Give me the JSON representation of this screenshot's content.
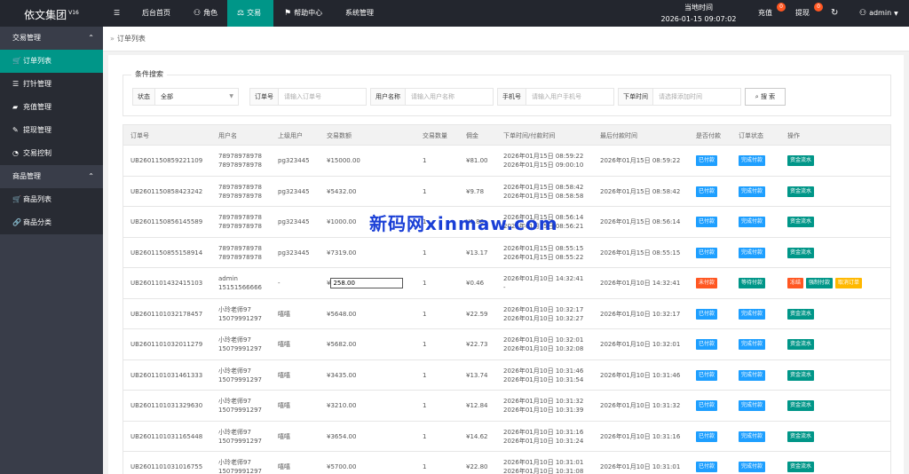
{
  "brand": {
    "name": "依文集团",
    "version": "V16"
  },
  "topnav": {
    "menu_icon": "☰",
    "items": [
      {
        "icon": "",
        "label": "后台首页"
      },
      {
        "icon": "user-icon",
        "label": "角色"
      },
      {
        "icon": "scale-icon",
        "label": "交易"
      },
      {
        "icon": "flag-icon",
        "label": "帮助中心"
      },
      {
        "icon": "",
        "label": "系统管理"
      }
    ],
    "time_label": "当地时间",
    "time_value": "2026-01-15 09:07:02",
    "recharge_label": "充值",
    "recharge_count": "0",
    "withdraw_label": "提现",
    "withdraw_count": "0",
    "refresh_icon": "refresh-icon",
    "user": "admin",
    "accent_color": "#009688"
  },
  "sidebar": {
    "groups": [
      {
        "label": "交易管理",
        "items": [
          {
            "icon": "cart-icon",
            "label": "订单列表"
          },
          {
            "icon": "list-icon",
            "label": "打针管理"
          },
          {
            "icon": "chat-icon",
            "label": "充值管理"
          },
          {
            "icon": "hammer-icon",
            "label": "提现管理"
          },
          {
            "icon": "dashboard-icon",
            "label": "交易控制"
          }
        ]
      },
      {
        "label": "商品管理",
        "items": [
          {
            "icon": "cart-icon",
            "label": "商品列表"
          },
          {
            "icon": "link-icon",
            "label": "商品分类"
          }
        ]
      }
    ]
  },
  "breadcrumb": "订单列表",
  "filter": {
    "legend": "条件搜索",
    "status_label": "状态",
    "status_value": "全部",
    "order_label": "订单号",
    "order_placeholder": "请输入订单号",
    "username_label": "用户名称",
    "username_placeholder": "请输入用户名称",
    "phone_label": "手机号",
    "phone_placeholder": "请输入用户手机号",
    "time_label": "下单时间",
    "time_placeholder": "请选择添加时间",
    "search_label": "搜 索"
  },
  "table": {
    "headers": [
      "订单号",
      "用户名",
      "上级用户",
      "交易数额",
      "交易数量",
      "佣金",
      "下单时间/付款时间",
      "最后付款时间",
      "是否付款",
      "订单状态",
      "操作"
    ],
    "rows": [
      {
        "order": "UB2601150859221109",
        "user1": "78978978978",
        "user2": "78978978978",
        "parent": "pg323445",
        "amount": "¥15000.00",
        "qty": "1",
        "commission": "¥81.00",
        "t1": "2026年01月15日 08:59:22",
        "t2": "2026年01月15日 09:00:10",
        "last": "2026年01月15日 08:59:22",
        "paid": "已付款",
        "paid_color": "blue",
        "status": "完成付款",
        "status_color": "blue",
        "actions": [
          "资金流水"
        ]
      },
      {
        "order": "UB2601150858423242",
        "user1": "78978978978",
        "user2": "78978978978",
        "parent": "pg323445",
        "amount": "¥5432.00",
        "qty": "1",
        "commission": "¥9.78",
        "t1": "2026年01月15日 08:58:42",
        "t2": "2026年01月15日 08:58:58",
        "last": "2026年01月15日 08:58:42",
        "paid": "已付款",
        "paid_color": "blue",
        "status": "完成付款",
        "status_color": "blue",
        "actions": [
          "资金流水"
        ]
      },
      {
        "order": "UB2601150856145589",
        "user1": "78978978978",
        "user2": "78978978978",
        "parent": "pg323445",
        "amount": "¥1000.00",
        "qty": "1",
        "commission": "¥1.80",
        "t1": "2026年01月15日 08:56:14",
        "t2": "2026年01月15日 08:56:21",
        "last": "2026年01月15日 08:56:14",
        "paid": "已付款",
        "paid_color": "blue",
        "status": "完成付款",
        "status_color": "blue",
        "actions": [
          "资金流水"
        ]
      },
      {
        "order": "UB2601150855158914",
        "user1": "78978978978",
        "user2": "78978978978",
        "parent": "pg323445",
        "amount": "¥7319.00",
        "qty": "1",
        "commission": "¥13.17",
        "t1": "2026年01月15日 08:55:15",
        "t2": "2026年01月15日 08:55:22",
        "last": "2026年01月15日 08:55:15",
        "paid": "已付款",
        "paid_color": "blue",
        "status": "完成付款",
        "status_color": "blue",
        "actions": [
          "资金流水"
        ]
      },
      {
        "order": "UB2601101432415103",
        "user1": "admin",
        "user2": "15151566666",
        "parent": "-",
        "amount": "¥",
        "amount_input": "258.00",
        "qty": "1",
        "commission": "¥0.46",
        "t1": "2026年01月10日 14:32:41",
        "t2": "-",
        "last": "2026年01月10日 14:32:41",
        "paid": "未付款",
        "paid_color": "red",
        "status": "等待付款",
        "status_color": "green",
        "actions": [
          "冻结",
          "强制付款",
          "取消订单"
        ]
      },
      {
        "order": "UB2601101032178457",
        "user1": "小玲老师97",
        "user2": "15079991297",
        "parent": "嘻嘻",
        "amount": "¥5648.00",
        "qty": "1",
        "commission": "¥22.59",
        "t1": "2026年01月10日 10:32:17",
        "t2": "2026年01月10日 10:32:27",
        "last": "2026年01月10日 10:32:17",
        "paid": "已付款",
        "paid_color": "blue",
        "status": "完成付款",
        "status_color": "blue",
        "actions": [
          "资金流水"
        ]
      },
      {
        "order": "UB2601101032011279",
        "user1": "小玲老师97",
        "user2": "15079991297",
        "parent": "嘻嘻",
        "amount": "¥5682.00",
        "qty": "1",
        "commission": "¥22.73",
        "t1": "2026年01月10日 10:32:01",
        "t2": "2026年01月10日 10:32:08",
        "last": "2026年01月10日 10:32:01",
        "paid": "已付款",
        "paid_color": "blue",
        "status": "完成付款",
        "status_color": "blue",
        "actions": [
          "资金流水"
        ]
      },
      {
        "order": "UB2601101031461333",
        "user1": "小玲老师97",
        "user2": "15079991297",
        "parent": "嘻嘻",
        "amount": "¥3435.00",
        "qty": "1",
        "commission": "¥13.74",
        "t1": "2026年01月10日 10:31:46",
        "t2": "2026年01月10日 10:31:54",
        "last": "2026年01月10日 10:31:46",
        "paid": "已付款",
        "paid_color": "blue",
        "status": "完成付款",
        "status_color": "blue",
        "actions": [
          "资金流水"
        ]
      },
      {
        "order": "UB2601101031329630",
        "user1": "小玲老师97",
        "user2": "15079991297",
        "parent": "嘻嘻",
        "amount": "¥3210.00",
        "qty": "1",
        "commission": "¥12.84",
        "t1": "2026年01月10日 10:31:32",
        "t2": "2026年01月10日 10:31:39",
        "last": "2026年01月10日 10:31:32",
        "paid": "已付款",
        "paid_color": "blue",
        "status": "完成付款",
        "status_color": "blue",
        "actions": [
          "资金流水"
        ]
      },
      {
        "order": "UB2601101031165448",
        "user1": "小玲老师97",
        "user2": "15079991297",
        "parent": "嘻嘻",
        "amount": "¥3654.00",
        "qty": "1",
        "commission": "¥14.62",
        "t1": "2026年01月10日 10:31:16",
        "t2": "2026年01月10日 10:31:24",
        "last": "2026年01月10日 10:31:16",
        "paid": "已付款",
        "paid_color": "blue",
        "status": "完成付款",
        "status_color": "blue",
        "actions": [
          "资金流水"
        ]
      },
      {
        "order": "UB2601101031016755",
        "user1": "小玲老师97",
        "user2": "15079991297",
        "parent": "嘻嘻",
        "amount": "¥5700.00",
        "qty": "1",
        "commission": "¥22.80",
        "t1": "2026年01月10日 10:31:01",
        "t2": "2026年01月10日 10:31:08",
        "last": "2026年01月10日 10:31:01",
        "paid": "已付款",
        "paid_color": "blue",
        "status": "完成付款",
        "status_color": "blue",
        "actions": [
          "资金流水"
        ]
      }
    ]
  },
  "watermark": "新码网xinmaw.com"
}
